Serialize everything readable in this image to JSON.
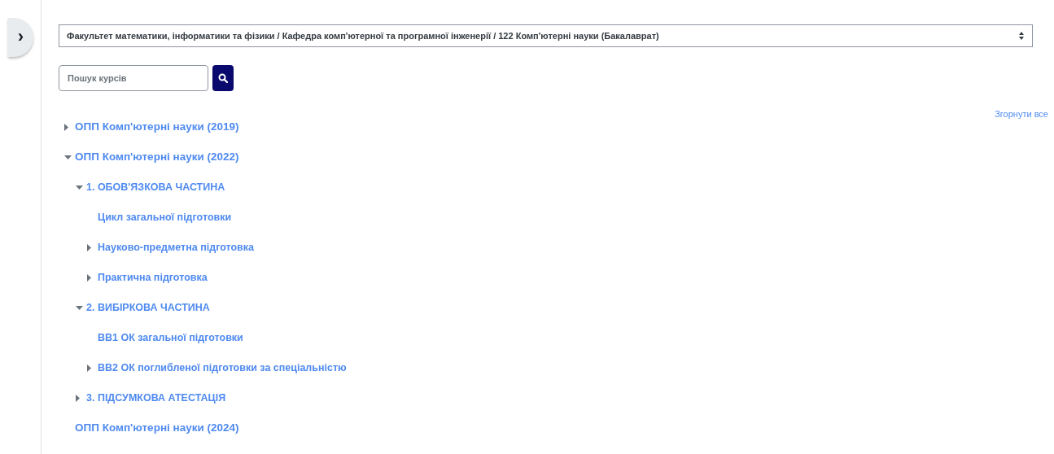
{
  "sidebar_toggle": {
    "icon": "›"
  },
  "category_select": {
    "value": "Факультет математики, інформатики та фізики / Кафедра комп'ютерної та програмної інженерії / 122 Комп'ютерні науки (Бакалаврат)"
  },
  "search": {
    "placeholder": "Пошук курсів"
  },
  "collapse_all": "Згорнути все",
  "tree": [
    {
      "label": "ОПП Комп'ютерні науки (2019)",
      "kind": "branch",
      "expanded": false
    },
    {
      "label": "ОПП Комп'ютерні науки (2022)",
      "kind": "branch",
      "expanded": true,
      "children": [
        {
          "label": "1. ОБОВ'ЯЗКОВА ЧАСТИНА",
          "kind": "branch",
          "expanded": true,
          "children": [
            {
              "label": "Цикл загальної підготовки",
              "kind": "leaf"
            },
            {
              "label": "Науково-предметна підготовка",
              "kind": "branch",
              "expanded": false
            },
            {
              "label": "Практична підготовка",
              "kind": "branch",
              "expanded": false
            }
          ]
        },
        {
          "label": "2. ВИБІРКОВА ЧАСТИНА",
          "kind": "branch",
          "expanded": true,
          "children": [
            {
              "label": "ВВ1 ОК загальної підготовки",
              "kind": "leaf"
            },
            {
              "label": "ВВ2 ОК поглибленої підготовки за спеціальністю",
              "kind": "branch",
              "expanded": false
            }
          ]
        },
        {
          "label": "3. ПІДСУМКОВА АТЕСТАЦІЯ",
          "kind": "branch",
          "expanded": false
        }
      ]
    },
    {
      "label": "ОПП Комп'ютерні науки (2024)",
      "kind": "leaf"
    }
  ]
}
